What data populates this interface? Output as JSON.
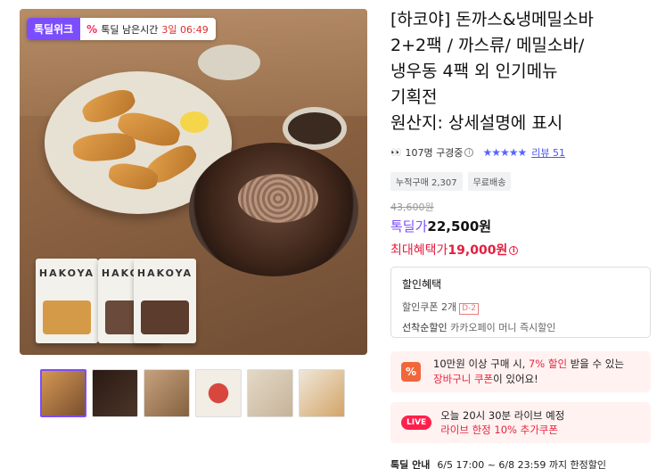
{
  "badge": {
    "tag": "톡딜위크",
    "percent": "%",
    "label": "톡딜 남은시간",
    "time": "3일 06:49"
  },
  "product_image": {
    "brand": "HAKOYA"
  },
  "thumbnails": [
    "thumb-1",
    "thumb-2",
    "thumb-3",
    "thumb-4",
    "thumb-5",
    "thumb-6"
  ],
  "title_lines": [
    "[하코야] 돈까스&냉메밀소바",
    "2+2팩 / 까스류/ 메밀소바/",
    "냉우동 4팩 외 인기메뉴",
    "기획전",
    "원산지: 상세설명에 표시"
  ],
  "viewers": {
    "eyes": "👀",
    "text": "107명 구경중",
    "info": "i",
    "stars": "★★★★★",
    "rating": 4.8,
    "review": "리뷰 51"
  },
  "chips": [
    "누적구매 2,307",
    "무료배송"
  ],
  "price": {
    "original": "43,600원",
    "deal_label": "톡딜가",
    "deal_value": "22,500원",
    "max_label": "최대혜택가",
    "max_value": "19,000원",
    "max_info": "i"
  },
  "benefit": {
    "title": "할인혜택",
    "coupon": "할인쿠폰 2개",
    "dday": "D-2",
    "first_label": "선착순할인",
    "first_text": "카카오페이 머니 즉시할인"
  },
  "coupon_banner": {
    "icon": "%",
    "line1_a": "10만원 이상 구매 시, ",
    "line1_b": "7% 할인",
    "line1_c": " 받을 수 있는",
    "line2_a": "장바구니 쿠폰",
    "line2_b": "이 있어요!"
  },
  "live_banner": {
    "badge": "LIVE",
    "line1": "오늘 20시 30분 라이브 예정",
    "line2": "라이브 한정 10% 추가쿠폰"
  },
  "bottom": {
    "label": "톡딜 안내",
    "text": "6/5 17:00 ~ 6/8 23:59 까지 한정할인"
  },
  "colors": {
    "accent": "#7b4dff",
    "sale_red": "#e51e3f",
    "banner_bg": "#fff2f1"
  }
}
